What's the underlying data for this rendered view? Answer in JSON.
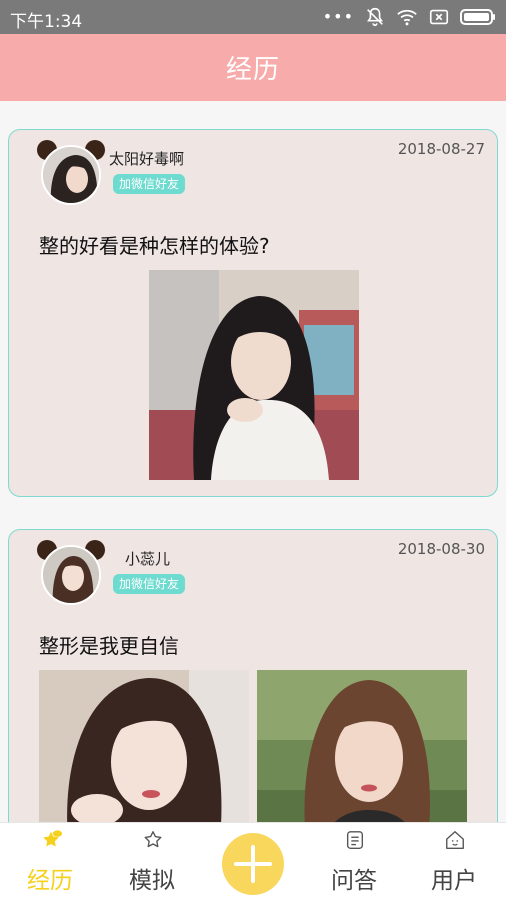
{
  "status_bar": {
    "time": "下午1:34",
    "icons": [
      "more-dots-icon",
      "mute-icon",
      "wifi-icon",
      "sim-x-icon",
      "battery-icon"
    ],
    "dots": "•••"
  },
  "header": {
    "title": "经历"
  },
  "posts": [
    {
      "username": "太阳好毒啊",
      "wechat_label": "加微信好友",
      "date": "2018-08-27",
      "title": "整的好看是种怎样的体验?"
    },
    {
      "username": "小蕊儿",
      "wechat_label": "加微信好友",
      "date": "2018-08-30",
      "title": "整形是我更自信"
    }
  ],
  "tabbar": {
    "tabs": [
      {
        "label": "经历",
        "icon": "bubble-star-icon",
        "active": true
      },
      {
        "label": "模拟",
        "icon": "star-icon",
        "active": false
      },
      {
        "label": "问答",
        "icon": "document-icon",
        "active": false
      },
      {
        "label": "用户",
        "icon": "home-icon",
        "active": false
      }
    ],
    "add_icon": "plus-icon"
  },
  "colors": {
    "header_bg": "#f8abab",
    "card_bg": "#efe5e3",
    "card_border": "#7fd9d0",
    "wechat_badge": "#6ddbcf",
    "active_tab": "#f5d11d",
    "add_button": "#f9d65c"
  }
}
